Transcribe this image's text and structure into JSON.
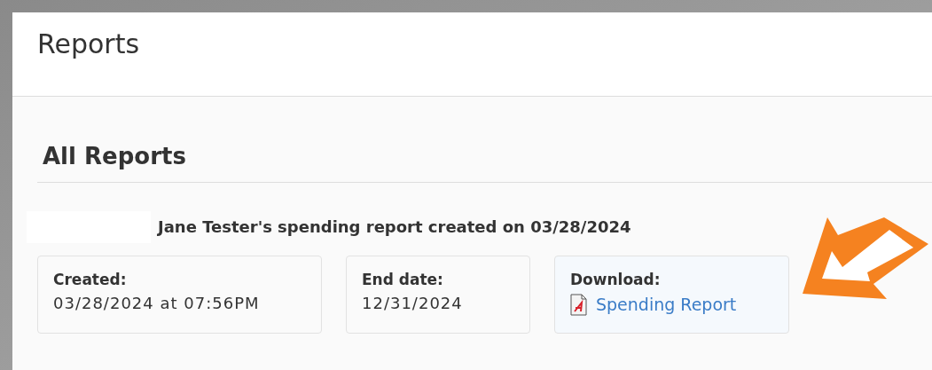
{
  "page": {
    "title": "Reports"
  },
  "section": {
    "title": "All Reports"
  },
  "report": {
    "heading": "Jane Tester's spending report created on 03/28/2024",
    "cards": [
      {
        "kind": "text",
        "label": "Created:",
        "value": "03/28/2024 at 07:56PM"
      },
      {
        "kind": "text",
        "label": "End date:",
        "value": "12/31/2024"
      },
      {
        "kind": "download",
        "label": "Download:",
        "value": "Spending Report"
      }
    ]
  }
}
